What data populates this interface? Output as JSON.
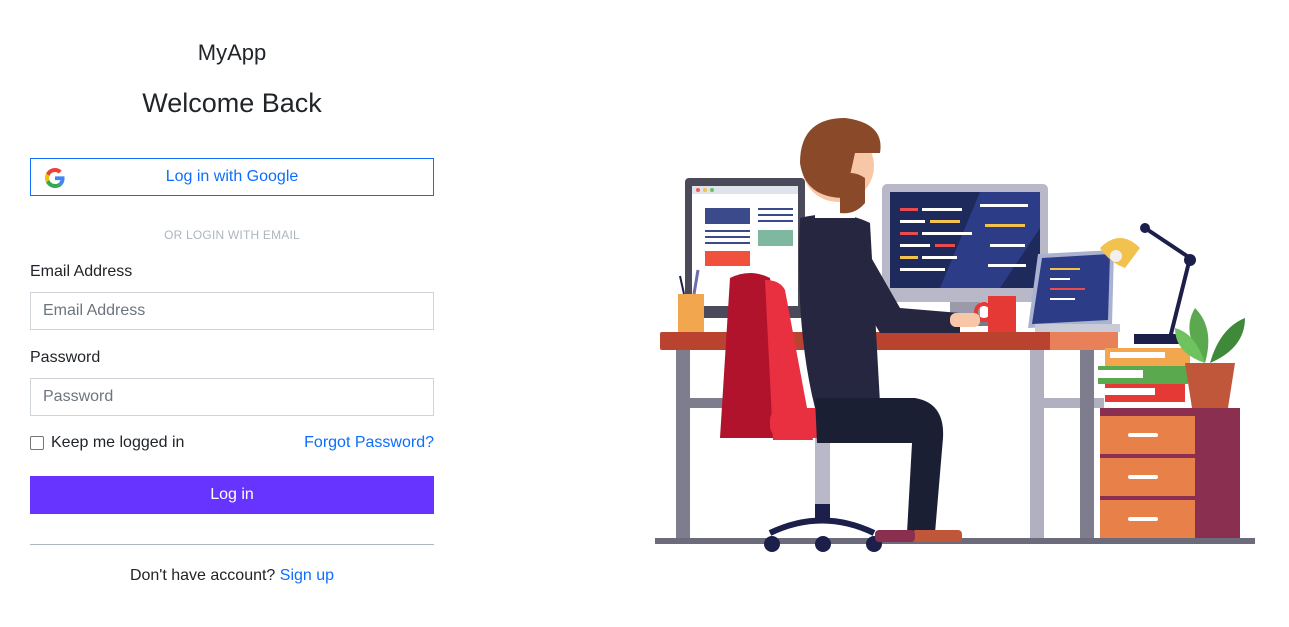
{
  "app": {
    "name": "MyApp",
    "heading": "Welcome Back"
  },
  "google_login": {
    "label": "Log in with Google",
    "icon": "google-icon"
  },
  "divider": {
    "text": "OR LOGIN WITH EMAIL"
  },
  "email": {
    "label": "Email Address",
    "placeholder": "Email Address",
    "value": ""
  },
  "password": {
    "label": "Password",
    "placeholder": "Password",
    "value": ""
  },
  "remember": {
    "label": "Keep me logged in",
    "checked": false
  },
  "forgot": {
    "label": "Forgot Password?"
  },
  "login_button": {
    "label": "Log in"
  },
  "signup": {
    "prompt": "Don't have account?",
    "link": "Sign up"
  },
  "colors": {
    "accent": "#6633ff",
    "link": "#0d6efd"
  }
}
